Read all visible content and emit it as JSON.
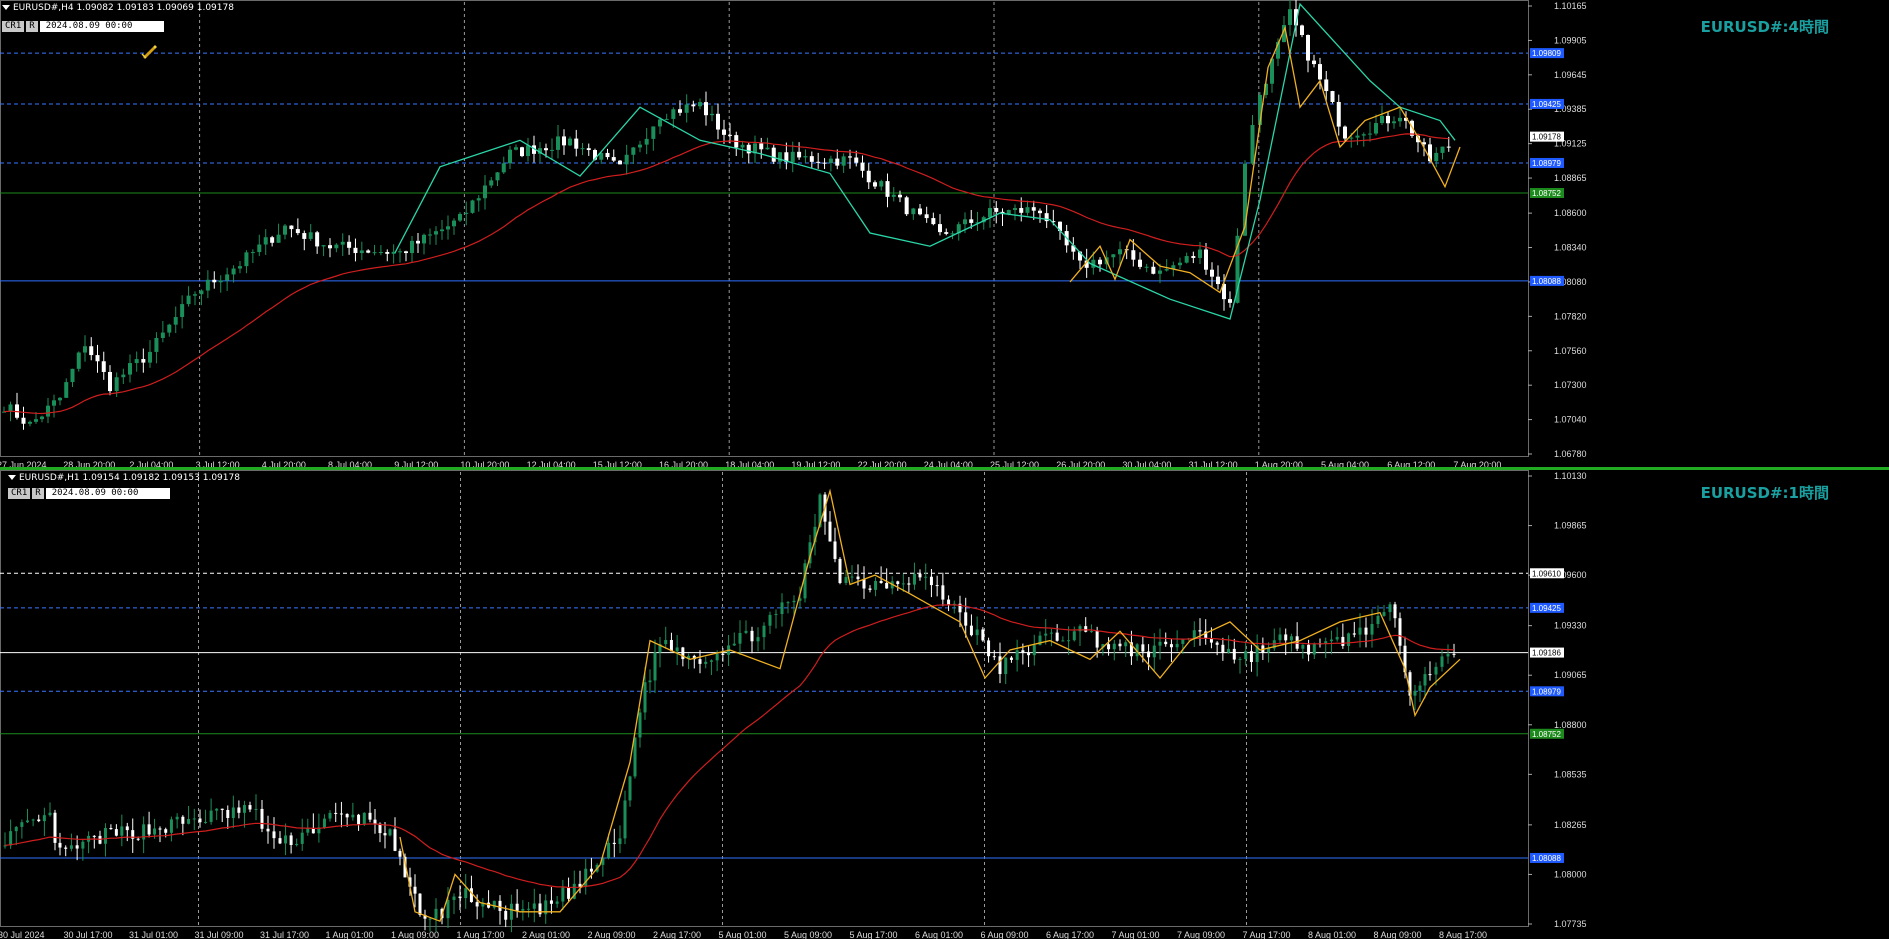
{
  "pane1": {
    "header": "EURUSD#,H4  1.09082 1.09183 1.09069 1.09178",
    "btn_cr": "CR1",
    "btn_r": "R",
    "datetime": "2024.08.09 00:00",
    "watermark": "EURUSD#:4時間",
    "price_ticks": [
      "1.10165",
      "1.09905",
      "1.09645",
      "1.09385",
      "1.09125",
      "1.08865",
      "1.08600",
      "1.08340",
      "1.08080",
      "1.07820",
      "1.07560",
      "1.07300",
      "1.07040",
      "1.06780"
    ],
    "time_labels": [
      "27 Jun 2024",
      "28 Jun 20:00",
      "2 Jul 04:00",
      "3 Jul 12:00",
      "4 Jul 20:00",
      "8 Jul 04:00",
      "9 Jul 12:00",
      "10 Jul 20:00",
      "12 Jul 04:00",
      "15 Jul 12:00",
      "16 Jul 20:00",
      "18 Jul 04:00",
      "19 Jul 12:00",
      "22 Jul 20:00",
      "24 Jul 04:00",
      "25 Jul 12:00",
      "26 Jul 20:00",
      "30 Jul 04:00",
      "31 Jul 12:00",
      "1 Aug 20:00",
      "5 Aug 04:00",
      "6 Aug 12:00",
      "7 Aug 20:00"
    ],
    "hlines": [
      {
        "price": "1.09809",
        "color": "#3a78ff",
        "style": "dashed",
        "label_bg": "#1e5aff"
      },
      {
        "price": "1.09425",
        "color": "#3a78ff",
        "style": "dashed",
        "label_bg": "#1e5aff"
      },
      {
        "price": "1.09178",
        "color": "#ffffff",
        "style": "none",
        "label_bg": "#ffffff"
      },
      {
        "price": "1.08979",
        "color": "#3a78ff",
        "style": "dashed",
        "label_bg": "#1e5aff"
      },
      {
        "price": "1.08752",
        "color": "#1c8a1c",
        "style": "solid",
        "label_bg": "#1c8a1c"
      },
      {
        "price": "1.08088",
        "color": "#2f6fff",
        "style": "solid",
        "label_bg": "#1e5aff"
      }
    ]
  },
  "pane2": {
    "header": "EURUSD#,H1  1.09154 1.09182 1.09153 1.09178",
    "btn_cr": "CR1",
    "btn_r": "R",
    "datetime": "2024.08.09 00:00",
    "watermark": "EURUSD#:1時間",
    "price_ticks": [
      "1.10130",
      "1.09865",
      "1.09600",
      "1.09330",
      "1.09065",
      "1.08800",
      "1.08535",
      "1.08265",
      "1.08000",
      "1.07735"
    ],
    "time_labels": [
      "30 Jul 2024",
      "30 Jul 17:00",
      "31 Jul 01:00",
      "31 Jul 09:00",
      "31 Jul 17:00",
      "1 Aug 01:00",
      "1 Aug 09:00",
      "1 Aug 17:00",
      "2 Aug 01:00",
      "2 Aug 09:00",
      "2 Aug 17:00",
      "5 Aug 01:00",
      "5 Aug 09:00",
      "5 Aug 17:00",
      "6 Aug 01:00",
      "6 Aug 09:00",
      "6 Aug 17:00",
      "7 Aug 01:00",
      "7 Aug 09:00",
      "7 Aug 17:00",
      "8 Aug 01:00",
      "8 Aug 09:00",
      "8 Aug 17:00"
    ],
    "hlines": [
      {
        "price": "1.09610",
        "color": "#ffffff",
        "style": "dashed",
        "label_bg": "#ffffff"
      },
      {
        "price": "1.09425",
        "color": "#3a78ff",
        "style": "dashed",
        "label_bg": "#1e5aff"
      },
      {
        "price": "1.09186",
        "color": "#ffffff",
        "style": "solid",
        "label_bg": "#ffffff"
      },
      {
        "price": "1.08979",
        "color": "#3a78ff",
        "style": "dashed",
        "label_bg": "#1e5aff"
      },
      {
        "price": "1.08752",
        "color": "#1c8a1c",
        "style": "solid",
        "label_bg": "#1c8a1c"
      },
      {
        "price": "1.08088",
        "color": "#2f6fff",
        "style": "solid",
        "label_bg": "#1e5aff"
      }
    ]
  },
  "colors": {
    "up": "#1b8f5a",
    "down": "#ffffff",
    "ma": "#d01e1e",
    "zz1": "#2ad6a8",
    "zz2": "#f0b020",
    "grid": "#8a8a8a"
  },
  "icons": {
    "pane1_tool": "pencil-tool-icon"
  }
}
